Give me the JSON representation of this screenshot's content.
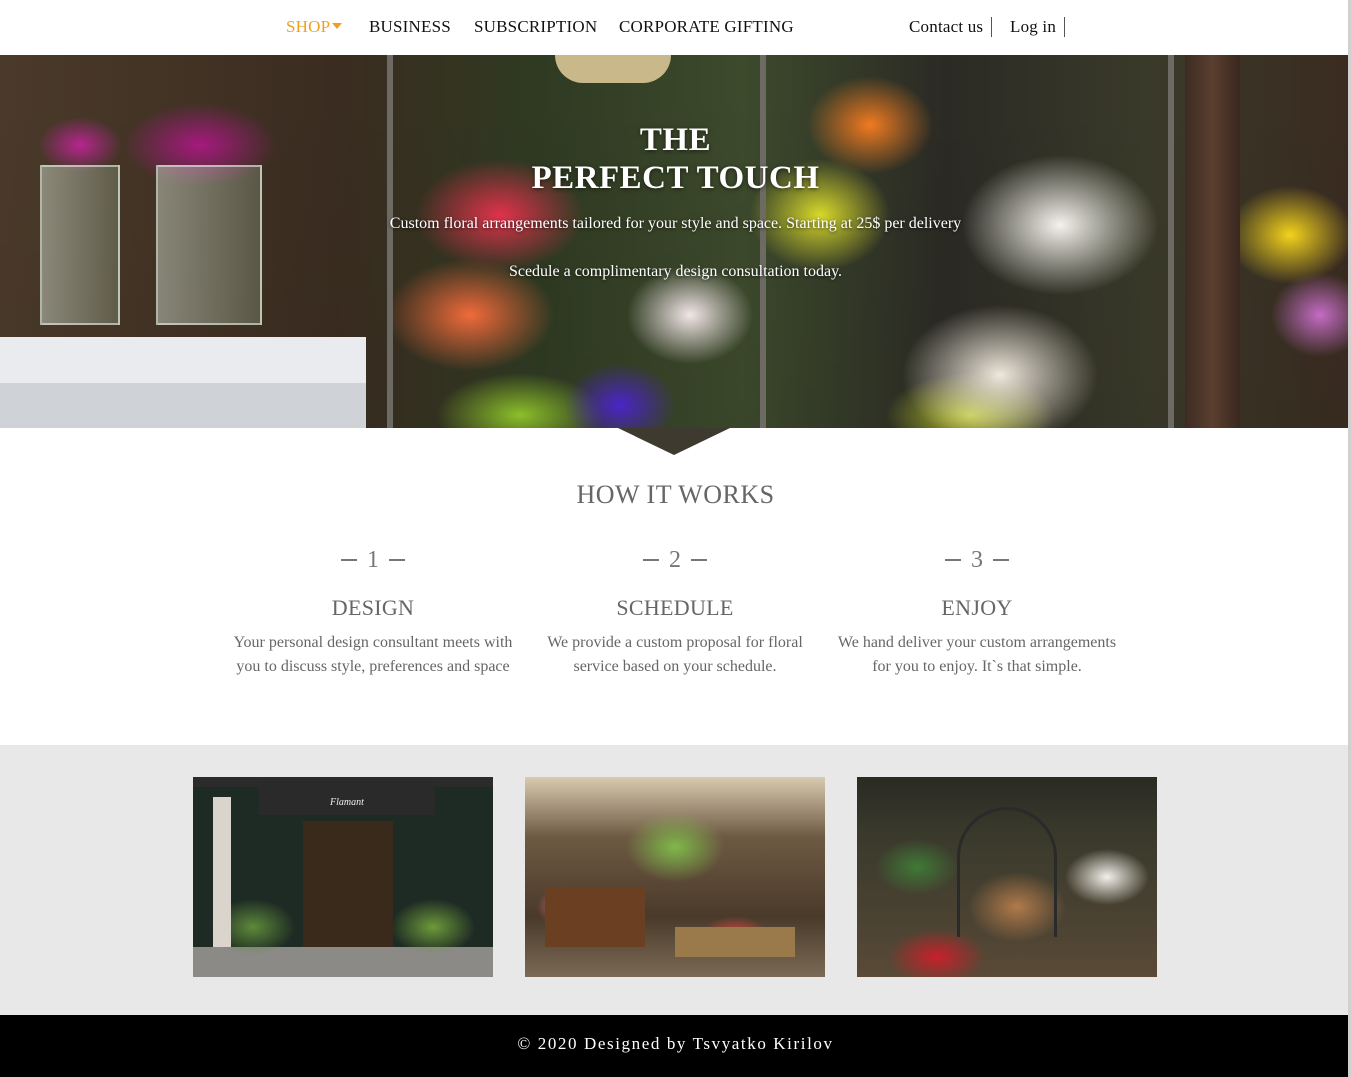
{
  "nav": {
    "items": [
      {
        "label": "SHOP",
        "active": true
      },
      {
        "label": "BUSINESS"
      },
      {
        "label": "SUBSCRIPTION"
      },
      {
        "label": "CORPORATE GIFTING"
      }
    ],
    "contact_label": "Contact us",
    "login_label": "Log in"
  },
  "hero": {
    "title_line1": "THE",
    "title_line2": "PERFECT TOUCH",
    "subtitle": "Custom floral arrangements tailored for your style and space. Starting at 25$ per delivery",
    "cta_text": "Scedule a complimentary design consultation today."
  },
  "how": {
    "title": "HOW IT WORKS",
    "steps": [
      {
        "number": "1",
        "heading": "DESIGN",
        "text": "Your personal design consultant meets with you to discuss style, preferences and space"
      },
      {
        "number": "2",
        "heading": "SCHEDULE",
        "text": "We provide a custom proposal for floral service based on your schedule."
      },
      {
        "number": "3",
        "heading": "ENJOY",
        "text": "We hand deliver your custom arrangements for you to enjoy. It`s that simple."
      }
    ]
  },
  "gallery": {
    "photos": [
      {
        "sign": "Flamant"
      },
      {},
      {}
    ]
  },
  "footer": {
    "text": "© 2020 Designed by Tsvyatko Kirilov"
  },
  "colors": {
    "accent": "#f0a020",
    "footer_bg": "#000000",
    "gallery_bg": "#e8e8e8"
  }
}
